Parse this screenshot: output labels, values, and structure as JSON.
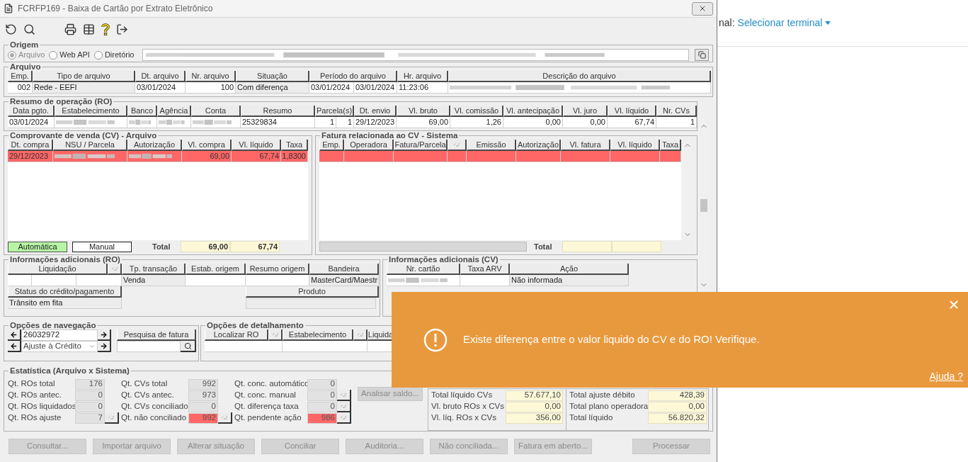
{
  "window": {
    "title": "FCRFP169 - Baixa de Cartão por Extrato Eletrônico"
  },
  "origem": {
    "title": "Origem",
    "options": [
      {
        "label": "Arquivo",
        "selected": true
      },
      {
        "label": "Web API",
        "selected": false
      },
      {
        "label": "Diretório",
        "selected": false
      }
    ]
  },
  "arquivo": {
    "title": "Arquivo",
    "columns": [
      "Emp.",
      "Tipo de arquivo",
      "Dt. arquivo",
      "Nr. arquivo",
      "Situação",
      "Período do arquivo",
      "Hr. arquivo",
      "Descrição do arquivo"
    ],
    "row": [
      {
        "kind": "text",
        "text": "002"
      },
      {
        "kind": "text",
        "text": "Rede - EEFI"
      },
      {
        "kind": "text",
        "text": "03/01/2024"
      },
      {
        "kind": "text",
        "text": "100"
      },
      {
        "kind": "text",
        "text": "Com diferença"
      },
      {
        "kind": "text",
        "text": "03/01/2024"
      },
      {
        "kind": "text",
        "text": "03/01/2024"
      },
      {
        "kind": "text",
        "text": "11:23:06"
      },
      {
        "kind": "blurred"
      }
    ]
  },
  "ro": {
    "title": "Resumo de operação (RO)",
    "columns": [
      "Data pgto.",
      "Estabelecimento",
      "Banco",
      "Agência",
      "Conta",
      "Resumo",
      "Parcela(s)",
      "Dt. envio",
      "Vl. bruto",
      "Vl. comissão",
      "Vl. antecipação",
      "Vl. juro",
      "Vl. líquido",
      "Nr. CVs"
    ],
    "row": [
      {
        "kind": "text",
        "text": "03/01/2024"
      },
      {
        "kind": "blurred"
      },
      {
        "kind": "blurred"
      },
      {
        "kind": "blurred"
      },
      {
        "kind": "blurred"
      },
      {
        "kind": "text",
        "text": "25329834"
      },
      {
        "kind": "text",
        "text": "1"
      },
      {
        "kind": "text",
        "text": "1"
      },
      {
        "kind": "text",
        "text": "29/12/2023"
      },
      {
        "kind": "text",
        "text": "69,00"
      },
      {
        "kind": "text",
        "text": "1,26"
      },
      {
        "kind": "text",
        "text": "0,00"
      },
      {
        "kind": "text",
        "text": "0,00"
      },
      {
        "kind": "text",
        "text": "67,74"
      },
      {
        "kind": "text",
        "text": "1"
      }
    ]
  },
  "cv_file": {
    "title": "Comprovante de venda (CV) - Arquivo",
    "columns": [
      "Dt. compra",
      "NSU / Parcela",
      "Autorização",
      "Vl. compra",
      "Vl. líquido",
      "Taxa"
    ],
    "rows": [
      {
        "flagged": true,
        "cells": [
          {
            "kind": "text",
            "text": "29/12/2023"
          },
          {
            "kind": "blurred"
          },
          {
            "kind": "blurred"
          },
          {
            "kind": "text",
            "text": "69,00"
          },
          {
            "kind": "text",
            "text": "67,74"
          },
          {
            "kind": "text",
            "text": "1,8300"
          }
        ]
      }
    ],
    "modes": [
      {
        "label": "Automática",
        "selected": true
      },
      {
        "label": "Manual",
        "selected": false
      }
    ],
    "total_label": "Total",
    "totals": [
      "69,00",
      "67,74"
    ]
  },
  "cv_system": {
    "title": "Fatura relacionada ao CV - Sistema",
    "columns": [
      {
        "kind": "text",
        "label": "Emp."
      },
      {
        "kind": "text",
        "label": "Operadora"
      },
      {
        "kind": "text",
        "label": "Fatura/Parcela"
      },
      {
        "kind": "icon"
      },
      {
        "kind": "text",
        "label": "Emissão"
      },
      {
        "kind": "text",
        "label": "Autorização"
      },
      {
        "kind": "text",
        "label": "Vl. fatura"
      },
      {
        "kind": "text",
        "label": "Vl. líquido"
      },
      {
        "kind": "text",
        "label": "Taxa"
      }
    ],
    "rows": [
      {
        "flagged": true,
        "cells": [
          {
            "kind": "empty"
          },
          {
            "kind": "empty"
          },
          {
            "kind": "empty"
          },
          {
            "kind": "empty"
          },
          {
            "kind": "empty"
          },
          {
            "kind": "empty"
          },
          {
            "kind": "empty"
          },
          {
            "kind": "empty"
          },
          {
            "kind": "empty"
          }
        ]
      }
    ],
    "total_label": "Total"
  },
  "info_ro": {
    "title": "Informações adicionais (RO)",
    "columns": [
      {
        "kind": "text",
        "label": "Liquidação"
      },
      {
        "kind": "icon"
      },
      {
        "kind": "text",
        "label": "Tp. transação"
      },
      {
        "kind": "text",
        "label": "Estab. origem"
      },
      {
        "kind": "text",
        "label": "Resumo origem"
      },
      {
        "kind": "text",
        "label": "Bandeira"
      }
    ],
    "row": [
      {
        "kind": "empty"
      },
      {
        "kind": "empty"
      },
      {
        "kind": "empty"
      },
      {
        "kind": "text",
        "text": "Venda"
      },
      {
        "kind": "empty"
      },
      {
        "kind": "empty"
      },
      {
        "kind": "text",
        "text": "MasterCard/Maestr"
      }
    ],
    "status_header": "Status do crédito/pagamento",
    "status": "Trânsito em fita",
    "product_header": "Produto"
  },
  "info_cv": {
    "title": "Informações adicionais (CV)",
    "columns": [
      "Nr. cartão",
      "Taxa ARV",
      "Ação"
    ],
    "row": [
      {
        "kind": "blurred"
      },
      {
        "kind": "empty"
      },
      {
        "kind": "text",
        "text": "Não informada"
      }
    ]
  },
  "navigation": {
    "title": "Opções de navegação",
    "number": "26032972",
    "type": "Ajuste à Crédito",
    "search_header": "Pesquisa de fatura"
  },
  "detail": {
    "title": "Opções de detalhamento",
    "columns": [
      {
        "kind": "text",
        "label": "Localizar RO"
      },
      {
        "kind": "icon"
      },
      {
        "kind": "text",
        "label": "Estabelecimento"
      },
      {
        "kind": "icon"
      },
      {
        "kind": "text",
        "label": "Liquida"
      }
    ]
  },
  "stats": {
    "title": "Estatística (Arquivo x Sistema)",
    "columns": [
      [
        {
          "label": "Qt. ROs total",
          "value": "176",
          "flagged": false,
          "action": false
        },
        {
          "label": "Qt. ROs antec.",
          "value": "0",
          "flagged": false,
          "action": false
        },
        {
          "label": "Qt. ROs liquidados",
          "value": "0",
          "flagged": false,
          "action": false
        },
        {
          "label": "Qt. ROs ajuste",
          "value": "7",
          "flagged": false,
          "action": true
        }
      ],
      [
        {
          "label": "Qt. CVs total",
          "value": "992",
          "flagged": false,
          "action": false
        },
        {
          "label": "Qt. CVs antec.",
          "value": "973",
          "flagged": false,
          "action": false
        },
        {
          "label": "Qt. CVs conciliado",
          "value": "0",
          "flagged": false,
          "action": false
        },
        {
          "label": "Qt. não conciliado",
          "value": "992",
          "flagged": true,
          "action": true
        }
      ],
      [
        {
          "label": "Qt. conc. automático",
          "value": "0",
          "flagged": false,
          "action": false
        },
        {
          "label": "Qt. conc. manual",
          "value": "0",
          "flagged": false,
          "action": true
        },
        {
          "label": "Qt. diferença taxa",
          "value": "0",
          "flagged": false,
          "action": true
        },
        {
          "label": "Qt. pendente ação",
          "value": "986",
          "flagged": true,
          "action": true
        }
      ]
    ],
    "analyze_button": {
      "label": "Analisar saldo...",
      "disabled": true
    },
    "totals": [
      [
        {
          "label": "Total líquido CVs",
          "value": "57.677,10"
        },
        {
          "label": "Vl. bruto ROs x CVs",
          "value": "0,00"
        },
        {
          "label": "Vl. líq. ROs x CVs",
          "value": "356,00"
        }
      ],
      [
        {
          "label": "Total ajuste débito",
          "value": "428,39"
        },
        {
          "label": "Total plano operadora",
          "value": "0,00"
        },
        {
          "label": "Total líquido",
          "value": "56.820,32"
        }
      ]
    ]
  },
  "buttons": [
    {
      "label": "Consultar...",
      "disabled": true
    },
    {
      "label": "Importar arquivo",
      "disabled": true
    },
    {
      "label": "Alterar situação",
      "disabled": true
    },
    {
      "label": "Conciliar",
      "disabled": true
    },
    {
      "label": "Auditoria...",
      "disabled": true
    },
    {
      "label": "Não conciliada...",
      "disabled": true
    },
    {
      "label": "Fatura em aberto...",
      "disabled": true
    },
    {
      "label": "Processar",
      "disabled": true
    }
  ],
  "toast": {
    "message": "Existe diferença entre o valor liquido do CV e do RO! Verifique.",
    "help_link": "Ajuda ?"
  },
  "web_page": {
    "label": "nal:",
    "link": "Selecionar terminal"
  }
}
